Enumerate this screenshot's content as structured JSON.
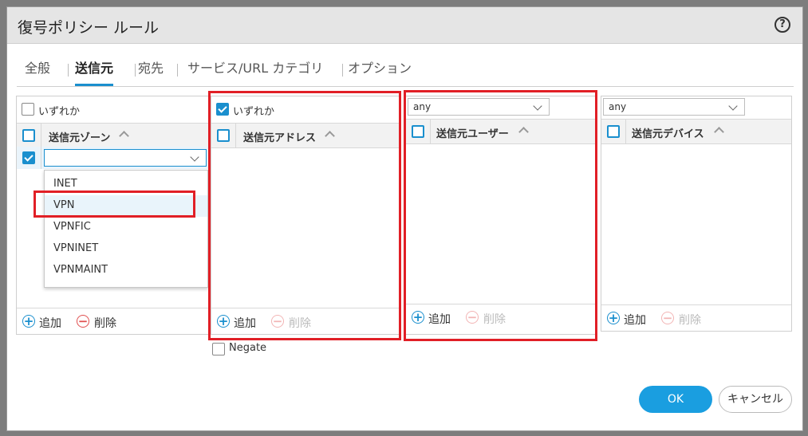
{
  "dialog": {
    "title": "復号ポリシー ルール",
    "help_glyph": "?"
  },
  "tabs": [
    {
      "label": "全般",
      "active": false
    },
    {
      "label": "送信元",
      "active": true
    },
    {
      "label": "宛先",
      "active": false
    },
    {
      "label": "サービス/URL カテゴリ",
      "active": false
    },
    {
      "label": "オプション",
      "active": false
    }
  ],
  "zone_panel": {
    "any_label": "いずれか",
    "any_checked": false,
    "column_header": "送信元ゾーン",
    "row_checked": true,
    "input_value": "",
    "dropdown_options": [
      "INET",
      "VPN",
      "VPNFIC",
      "VPNINET",
      "VPNMAINT"
    ],
    "highlighted_option": "VPN",
    "add_label": "追加",
    "delete_label": "削除"
  },
  "address_panel": {
    "any_label": "いずれか",
    "any_checked": true,
    "column_header": "送信元アドレス",
    "add_label": "追加",
    "delete_label": "削除",
    "negate_label": "Negate",
    "negate_checked": false
  },
  "user_panel": {
    "select_value": "any",
    "column_header": "送信元ユーザー",
    "add_label": "追加",
    "delete_label": "削除"
  },
  "device_panel": {
    "select_value": "any",
    "column_header": "送信元デバイス",
    "add_label": "追加",
    "delete_label": "削除"
  },
  "buttons": {
    "ok_label": "OK",
    "cancel_label": "キャンセル"
  },
  "colors": {
    "accent": "#1a8fce",
    "ok_button": "#1a9ee0",
    "highlight_box": "#e11f26",
    "delete_icon": "#e05050"
  },
  "icons": {
    "add": "+",
    "delete": "−"
  }
}
